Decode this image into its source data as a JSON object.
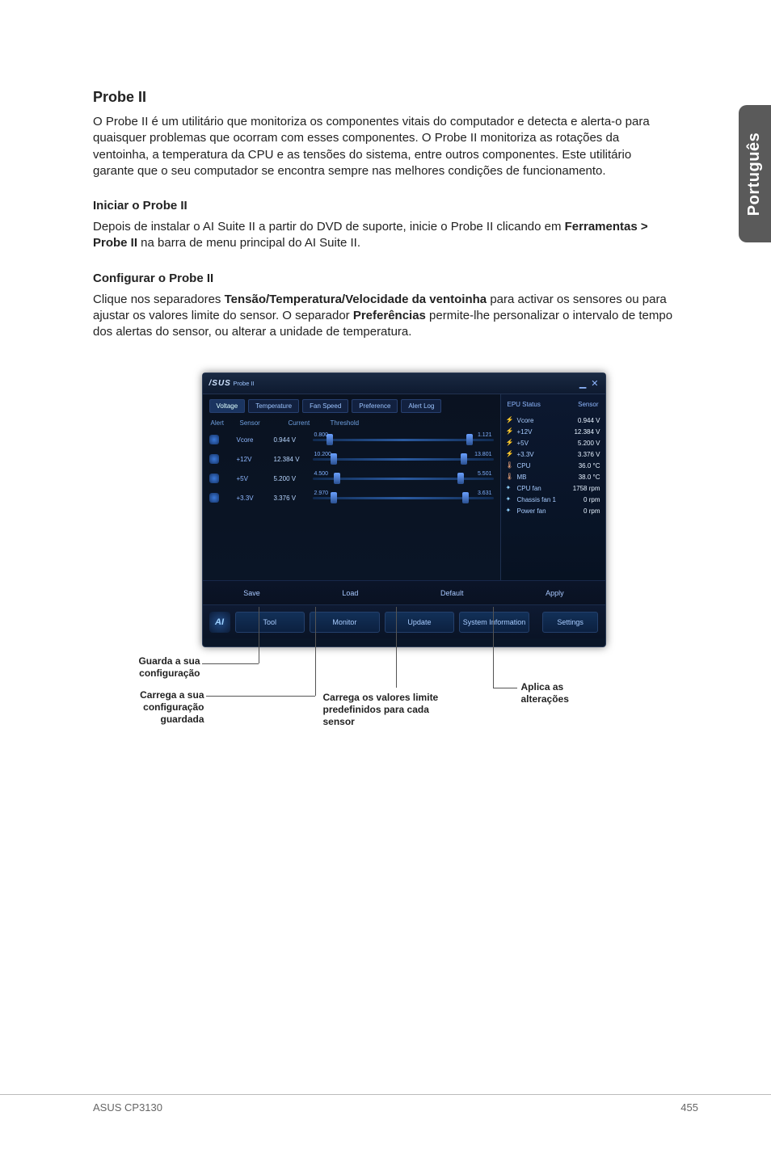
{
  "side_tab": "Português",
  "title": "Probe II",
  "intro": "O Probe II é um utilitário que monitoriza os componentes vitais do computador e detecta e alerta-o para quaisquer problemas que ocorram com esses componentes. O Probe II monitoriza as rotações da ventoinha, a temperatura da CPU e as tensões do sistema, entre outros componentes. Este utilitário garante que o seu computador se encontra sempre nas melhores condições de funcionamento.",
  "start_heading": "Iniciar o Probe II",
  "start_text_prefix": "Depois de instalar o AI Suite II a partir do DVD de suporte, inicie o Probe II clicando em ",
  "start_text_bold": "Ferramentas > Probe II",
  "start_text_suffix": " na barra de menu principal do AI Suite II.",
  "config_heading": "Configurar o Probe II",
  "config_text_prefix": "Clique nos separadores ",
  "config_text_bold1": "Tensão/Temperatura/Velocidade da ventoinha",
  "config_text_mid": " para activar os sensores ou para ajustar os valores limite do sensor. O separador ",
  "config_text_bold2": "Preferências",
  "config_text_suffix": " permite-lhe personalizar o intervalo de tempo dos alertas do sensor, ou alterar a unidade de temperatura.",
  "app": {
    "brand": "/SUS",
    "brand_sub": "Probe II",
    "tabs": [
      "Voltage",
      "Temperature",
      "Fan Speed",
      "Preference",
      "Alert Log"
    ],
    "columns": [
      "Alert",
      "Sensor",
      "Current",
      "Threshold"
    ],
    "rows": [
      {
        "sensor": "Vcore",
        "current": "0.944 V",
        "low": "0.800",
        "high": "1.121"
      },
      {
        "sensor": "+12V",
        "current": "12.384 V",
        "low": "10.200",
        "high": "13.801"
      },
      {
        "sensor": "+5V",
        "current": "5.200 V",
        "low": "4.500",
        "high": "5.501"
      },
      {
        "sensor": "+3.3V",
        "current": "3.376 V",
        "low": "2.970",
        "high": "3.631"
      }
    ],
    "actions": {
      "save": "Save",
      "load": "Load",
      "default": "Default",
      "apply": "Apply"
    },
    "bottom": {
      "tool": "Tool",
      "monitor": "Monitor",
      "update": "Update",
      "sysinfo": "System Information",
      "settings": "Settings"
    },
    "status": {
      "head_left": "EPU Status",
      "head_right": "Sensor",
      "items": [
        {
          "type": "bolt",
          "name": "Vcore",
          "value": "0.944 V"
        },
        {
          "type": "bolt",
          "name": "+12V",
          "value": "12.384 V"
        },
        {
          "type": "bolt",
          "name": "+5V",
          "value": "5.200 V"
        },
        {
          "type": "bolt",
          "name": "+3.3V",
          "value": "3.376 V"
        },
        {
          "type": "therm",
          "name": "CPU",
          "value": "36.0 °C"
        },
        {
          "type": "therm",
          "name": "MB",
          "value": "38.0 °C"
        },
        {
          "type": "fan",
          "name": "CPU fan",
          "value": "1758 rpm"
        },
        {
          "type": "fan",
          "name": "Chassis fan 1",
          "value": "0 rpm"
        },
        {
          "type": "fan",
          "name": "Power fan",
          "value": "0 rpm"
        }
      ]
    }
  },
  "callouts": {
    "save": "Guarda a sua configuração",
    "load": "Carrega a sua configuração guardada",
    "default": "Carrega os valores limite predefinidos para cada sensor",
    "apply": "Aplica as alterações"
  },
  "footer": {
    "left": "ASUS CP3130",
    "right": "455"
  }
}
